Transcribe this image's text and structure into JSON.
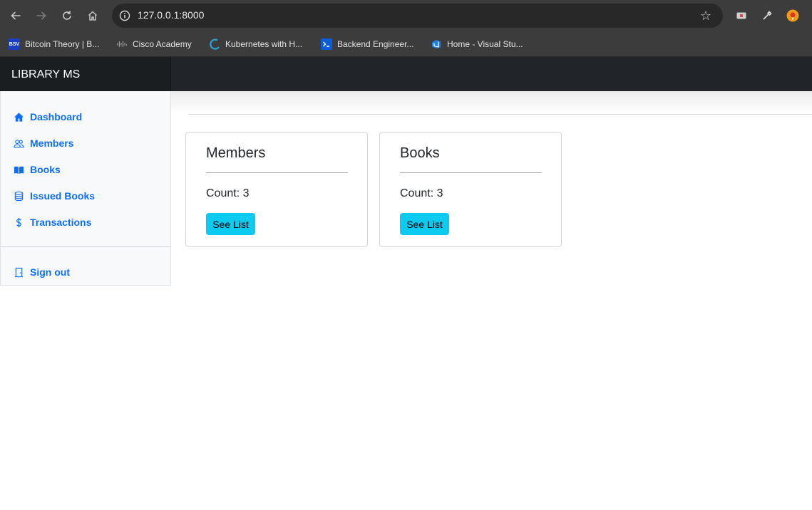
{
  "browser": {
    "url": "127.0.0.1:8000",
    "bookmarks": [
      {
        "label": "Bitcoin Theory | B...",
        "icon": "bsv-icon",
        "icon_text": "BSV",
        "color": "#1a3fbf"
      },
      {
        "label": "Cisco Academy",
        "icon": "cisco-icon",
        "color": "#6b6b6b"
      },
      {
        "label": "Kubernetes with H...",
        "icon": "kubernetes-icon",
        "color": "#2aa3d8"
      },
      {
        "label": "Backend Engineer...",
        "icon": "terminal-icon",
        "color": "#0b5cd6"
      },
      {
        "label": "Home - Visual Stu...",
        "icon": "azure-devops-icon",
        "color": "#1f7fe0"
      }
    ]
  },
  "app": {
    "brand": "LIBRARY MS",
    "colors": {
      "link": "#0d6efd",
      "header": "#212529",
      "info_button": "#0dcaf0"
    },
    "sidebar": {
      "items": [
        {
          "label": "Dashboard",
          "icon": "house-icon"
        },
        {
          "label": "Members",
          "icon": "people-icon"
        },
        {
          "label": "Books",
          "icon": "book-icon"
        },
        {
          "label": "Issued Books",
          "icon": "database-icon"
        },
        {
          "label": "Transactions",
          "icon": "dollar-icon"
        }
      ],
      "signout": {
        "label": "Sign out",
        "icon": "door-icon"
      }
    },
    "cards": [
      {
        "title": "Members",
        "count": "Count: 3",
        "button": "See List"
      },
      {
        "title": "Books",
        "count": "Count: 3",
        "button": "See List"
      }
    ]
  }
}
